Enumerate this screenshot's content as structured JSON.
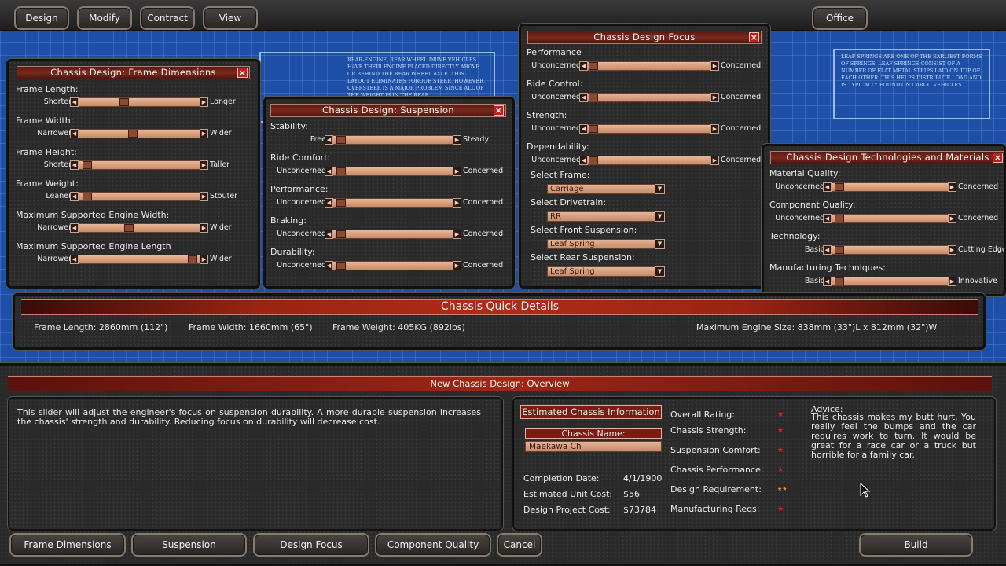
{
  "topbar": {
    "design": "Design",
    "modify": "Modify",
    "contract": "Contract",
    "view": "View",
    "office": "Office"
  },
  "blueprint_notes": {
    "rear_engine": "Rear-Engine, Rear Wheel Drive vehicles have their engine placed directly above or behind the rear wheel axle. This layout eliminates torque steer, however, oversteer is a major problem since all of the weight is in the rear.",
    "leaf_springs": "Leaf Springs are one of the earliest forms of springs. Leaf springs consist of a number of flat metal strips laid on top of each other. This helps distribute load and is typically found on cargo vehicles."
  },
  "frame_panel": {
    "title": "Chassis Design: Frame Dimensions",
    "rows": [
      {
        "label": "Frame Length:",
        "left": "Shorter",
        "right": "Longer",
        "value": 0.36
      },
      {
        "label": "Frame Width:",
        "left": "Narrower",
        "right": "Wider",
        "value": 0.44
      },
      {
        "label": "Frame Height:",
        "left": "Shorter",
        "right": "Taller",
        "value": 0.03
      },
      {
        "label": "Frame Weight:",
        "left": "Leaner",
        "right": "Stouter",
        "value": 0.03
      },
      {
        "label": "Maximum Supported Engine Width:",
        "left": "Narrower",
        "right": "Wider",
        "value": 0.4
      },
      {
        "label": "Maximum Supported Engine Length",
        "left": "Narrower",
        "right": "Wider",
        "value": 0.97
      }
    ]
  },
  "suspension_panel": {
    "title": "Chassis Design: Suspension",
    "rows": [
      {
        "label": "Stability:",
        "left": "Free",
        "right": "Steady",
        "value": 0.02
      },
      {
        "label": "Ride Comfort:",
        "left": "Unconcerned",
        "right": "Concerned",
        "value": 0.02
      },
      {
        "label": "Performance:",
        "left": "Unconcerned",
        "right": "Concerned",
        "value": 0.02
      },
      {
        "label": "Braking:",
        "left": "Unconcerned",
        "right": "Concerned",
        "value": 0.02
      },
      {
        "label": "Durability:",
        "left": "Unconcerned",
        "right": "Concerned",
        "value": 0.02
      }
    ]
  },
  "focus_panel": {
    "title": "Chassis Design Focus",
    "rows": [
      {
        "label": "Performance",
        "left": "Unconcerned",
        "right": "Concerned",
        "value": 0.0
      },
      {
        "label": "Ride Control:",
        "left": "Unconcerned",
        "right": "Concerned",
        "value": 0.0
      },
      {
        "label": "Strength:",
        "left": "Unconcerned",
        "right": "Concerned",
        "value": 0.0
      },
      {
        "label": "Dependability:",
        "left": "Unconcerned",
        "right": "Concerned",
        "value": 0.0
      }
    ],
    "selects": [
      {
        "label": "Select Frame:",
        "value": "Carriage"
      },
      {
        "label": "Select Drivetrain:",
        "value": "RR"
      },
      {
        "label": "Select Front Suspension:",
        "value": "Leaf Spring"
      },
      {
        "label": "Select Rear Suspension:",
        "value": "Leaf Spring"
      }
    ]
  },
  "tech_panel": {
    "title": "Chassis Design Technologies and Materials",
    "rows": [
      {
        "label": "Material Quality:",
        "left": "Unconcerned",
        "right": "Concerned",
        "value": 0.02
      },
      {
        "label": "Component Quality:",
        "left": "Unconcerned",
        "right": "Concerned",
        "value": 0.02
      },
      {
        "label": "Technology:",
        "left": "Basic",
        "right": "Cutting Edge",
        "value": 0.02
      },
      {
        "label": "Manufacturing Techniques:",
        "left": "Basic",
        "right": "Innovative",
        "value": 0.02
      }
    ]
  },
  "quick_details": {
    "title": "Chassis Quick Details",
    "frame_length": "Frame Length: 2860mm  (112\")",
    "frame_width": "Frame Width: 1660mm  (65\")",
    "frame_weight": "Frame Weight: 405KG  (892lbs)",
    "max_engine": "Maximum Engine Size:  838mm  (33\")L  x  812mm  (32\")W"
  },
  "overview": {
    "title": "New Chassis Design: Overview",
    "description": "This slider will adjust the engineer's focus on suspension durability. A more durable suspension increases the chassis' strength and durability. Reducing focus on durability will decrease cost.",
    "est_info": "Estimated Chassis Information",
    "name_label": "Chassis Name:",
    "name_value": "Maekawa Ch",
    "completion_label": "Completion Date:",
    "completion_value": "4/1/1900",
    "unit_cost_label": "Estimated Unit Cost:",
    "unit_cost_value": "$56",
    "project_cost_label": "Design Project Cost:",
    "project_cost_value": "$73784",
    "ratings": [
      {
        "label": "Overall Rating:",
        "stars": 0.5
      },
      {
        "label": "Chassis Strength:",
        "stars": 0.5
      },
      {
        "label": "Suspension Comfort:",
        "stars": 0.5
      },
      {
        "label": "Chassis Performance:",
        "stars": 0.5
      },
      {
        "label": "Design Requirement:",
        "stars": 1
      },
      {
        "label": "Manufacturing Reqs:",
        "stars": 0.5
      }
    ],
    "advice_label": "Advice:",
    "advice_text": "This chassis makes my butt hurt. You really feel the bumps and the car requires work to turn. It would be great for a race car or a truck but horrible for a family car."
  },
  "bottom_buttons": {
    "frame": "Frame Dimensions",
    "suspension": "Suspension",
    "focus": "Design Focus",
    "component": "Component Quality",
    "cancel": "Cancel",
    "build": "Build"
  },
  "colors": {
    "accent_red": "#9a2414",
    "slider": "#d9a07e",
    "blueprint": "#1d4fa6"
  }
}
